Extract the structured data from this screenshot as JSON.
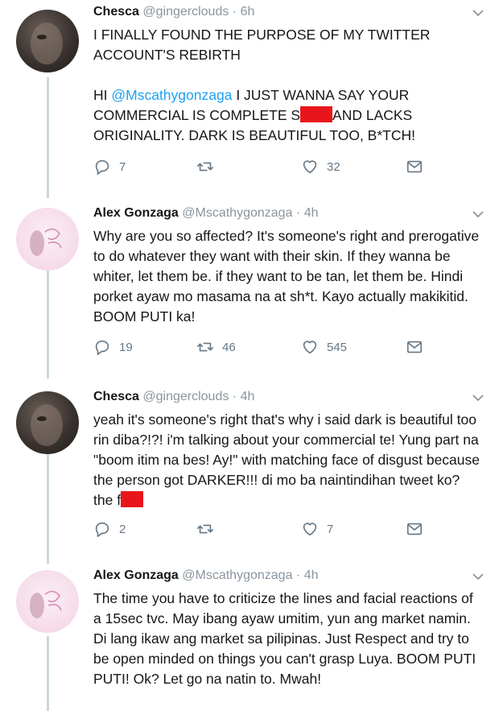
{
  "tweets": [
    {
      "name": "Chesca",
      "handle": "@gingerclouds",
      "time": "6h",
      "line1": "I FINALLY FOUND THE PURPOSE OF MY TWITTER ACCOUNT'S REBIRTH",
      "l2a": "HI ",
      "mention": "@Mscathygonzaga",
      "l2b": " I JUST WANNA SAY YOUR COMMERCIAL IS COMPLETE S",
      "l2c": "AND LACKS ORIGINALITY.  DARK IS BEAUTIFUL TOO, B*TCH!",
      "replies": "7",
      "retweets": "",
      "likes": "32"
    },
    {
      "name": "Alex Gonzaga",
      "handle": "@Mscathygonzaga",
      "time": "4h",
      "text": "Why are you so affected? It's someone's right and prerogative to do whatever they want with their skin. If they wanna be whiter, let them be. if they want to be tan, let them be. Hindi porket ayaw mo masama na at sh*t. Kayo actually makikitid. BOOM PUTI ka!",
      "replies": "19",
      "retweets": "46",
      "likes": "545"
    },
    {
      "name": "Chesca",
      "handle": "@gingerclouds",
      "time": "4h",
      "text": "yeah it's someone's right that's why i said dark is beautiful too rin diba?!?! i'm talking about your commercial te! Yung part na \"boom itim na bes! Ay!\" with matching face of disgust because the person got DARKER!!! di mo ba naintindihan tweet ko? the f",
      "replies": "2",
      "retweets": "",
      "likes": "7"
    },
    {
      "name": "Alex Gonzaga",
      "handle": "@Mscathygonzaga",
      "time": "4h",
      "text": "The time you have to criticize the lines and facial reactions of a 15sec tvc. May ibang ayaw umitim, yun ang market namin. Di lang ikaw ang market sa pilipinas. Just Respect and try to be open minded on things you can't grasp Luya. BOOM PUTI PUTI! Ok? Let go na natin to. Mwah!"
    }
  ],
  "separator": " · ",
  "colors": {
    "link": "#1da1f2",
    "icon": "#657786",
    "redaction": "#e8161c",
    "thread": "#ccd6dd"
  },
  "icons": [
    "reply-icon",
    "retweet-icon",
    "like-icon",
    "dm-icon",
    "chevron-down-icon"
  ]
}
